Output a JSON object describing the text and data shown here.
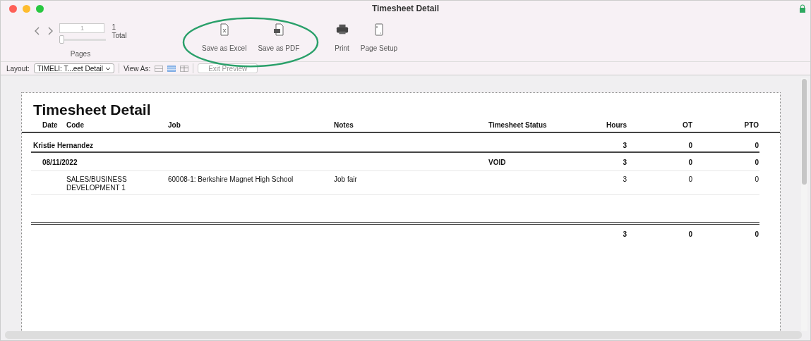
{
  "window": {
    "title": "Timesheet Detail"
  },
  "toolbar": {
    "page_field": {
      "value": "1"
    },
    "page_slider": {
      "level": 0
    },
    "total_count": "1",
    "total_label": "Total",
    "pages_label": "Pages",
    "buttons": [
      {
        "kind": "excel",
        "label": "Save as Excel"
      },
      {
        "kind": "pdf",
        "label": "Save as PDF"
      },
      {
        "kind": "print",
        "label": "Print"
      },
      {
        "kind": "setup",
        "label": "Page Setup"
      }
    ]
  },
  "layout_bar": {
    "layout_label": "Layout:",
    "layout_value": "TIMELI: T...eet Detail",
    "view_as_label": "View As:",
    "view_modes": [
      {
        "kind": "form",
        "selected": false
      },
      {
        "kind": "list",
        "selected": true
      },
      {
        "kind": "table",
        "selected": false
      }
    ],
    "exit_button": {
      "label": "Exit Preview",
      "disabled": true
    }
  },
  "report": {
    "title": "Timesheet Detail",
    "columns": [
      "Date",
      "Code",
      "Job",
      "Notes",
      "Timesheet Status",
      "Hours",
      "OT",
      "PTO"
    ],
    "employee": {
      "name": "Kristie Hernandez",
      "hours": "3",
      "ot": "0",
      "pto": "0"
    },
    "date_group": {
      "date": "08/11/2022",
      "status": "VOID",
      "hours": "3",
      "ot": "0",
      "pto": "0"
    },
    "rows": [
      {
        "code": "SALES/BUSINESS DEVELOPMENT 1",
        "job": "60008-1: Berkshire Magnet High School",
        "notes": "Job fair",
        "hours": "3",
        "ot": "0",
        "pto": "0"
      }
    ],
    "totals": {
      "hours": "3",
      "ot": "0",
      "pto": "0"
    }
  }
}
